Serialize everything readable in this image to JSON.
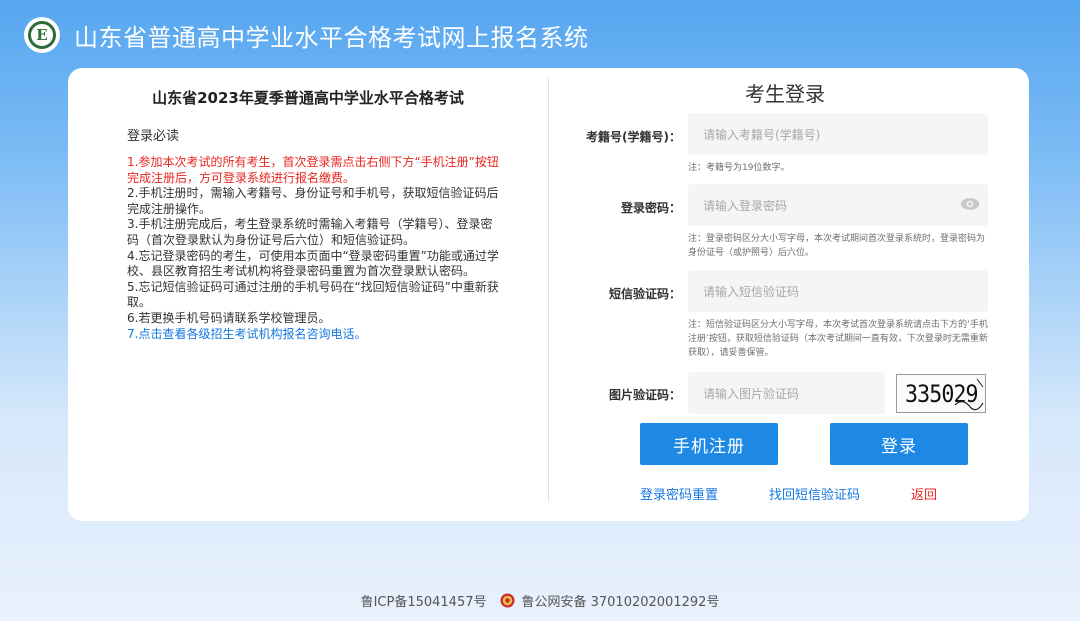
{
  "header": {
    "logo_letter": "E",
    "title": "山东省普通高中学业水平合格考试网上报名系统"
  },
  "left": {
    "exam_title": "山东省2023年夏季普通高中学业水平合格考试",
    "must_read": "登录必读",
    "notes": [
      "1.参加本次考试的所有考生，首次登录需点击右侧下方“手机注册”按钮完成注册后，方可登录系统进行报名缴费。",
      "2.手机注册时，需输入考籍号、身份证号和手机号，获取短信验证码后完成注册操作。",
      "3.手机注册完成后，考生登录系统时需输入考籍号（学籍号）、登录密码（首次登录默认为身份证号后六位）和短信验证码。",
      "4.忘记登录密码的考生，可使用本页面中“登录密码重置”功能或通过学校、县区教育招生考试机构将登录密码重置为首次登录默认密码。",
      "5.忘记短信验证码可通过注册的手机号码在“找回短信验证码”中重新获取。",
      "6.若更换手机号码请联系学校管理员。"
    ],
    "note7_prefix": "7.",
    "note7_link": "点击查看各级招生考试机构报名咨询电话。"
  },
  "login": {
    "title": "考生登录",
    "exam_id_label": "考籍号(学籍号)：",
    "exam_id_placeholder": "请输入考籍号(学籍号)",
    "exam_id_hint": "注：考籍号为19位数字。",
    "password_label": "登录密码：",
    "password_placeholder": "请输入登录密码",
    "password_hint": "注：登录密码区分大小写字母，本次考试期间首次登录系统时，登录密码为身份证号（或护照号）后六位。",
    "sms_label": "短信验证码：",
    "sms_placeholder": "请输入短信验证码",
    "sms_hint": "注：短信验证码区分大小写字母，本次考试首次登录系统请点击下方的‘手机注册’按钮，获取短信验证码（本次考试期间一直有效，下次登录时无需重新获取），请妥善保管。",
    "captcha_label": "图片验证码：",
    "captcha_placeholder": "请输入图片验证码",
    "captcha_value": "335029",
    "register_button": "手机注册",
    "login_button": "登录",
    "reset_password_link": "登录密码重置",
    "recover_sms_link": "找回短信验证码",
    "back_link": "返回"
  },
  "footer": {
    "icp": "鲁ICP备15041457号",
    "police": "鲁公网安备 37010202001292号"
  },
  "colors": {
    "primary": "#1e88e5",
    "link_blue": "#1677e0",
    "alert_red": "#e8261f"
  }
}
